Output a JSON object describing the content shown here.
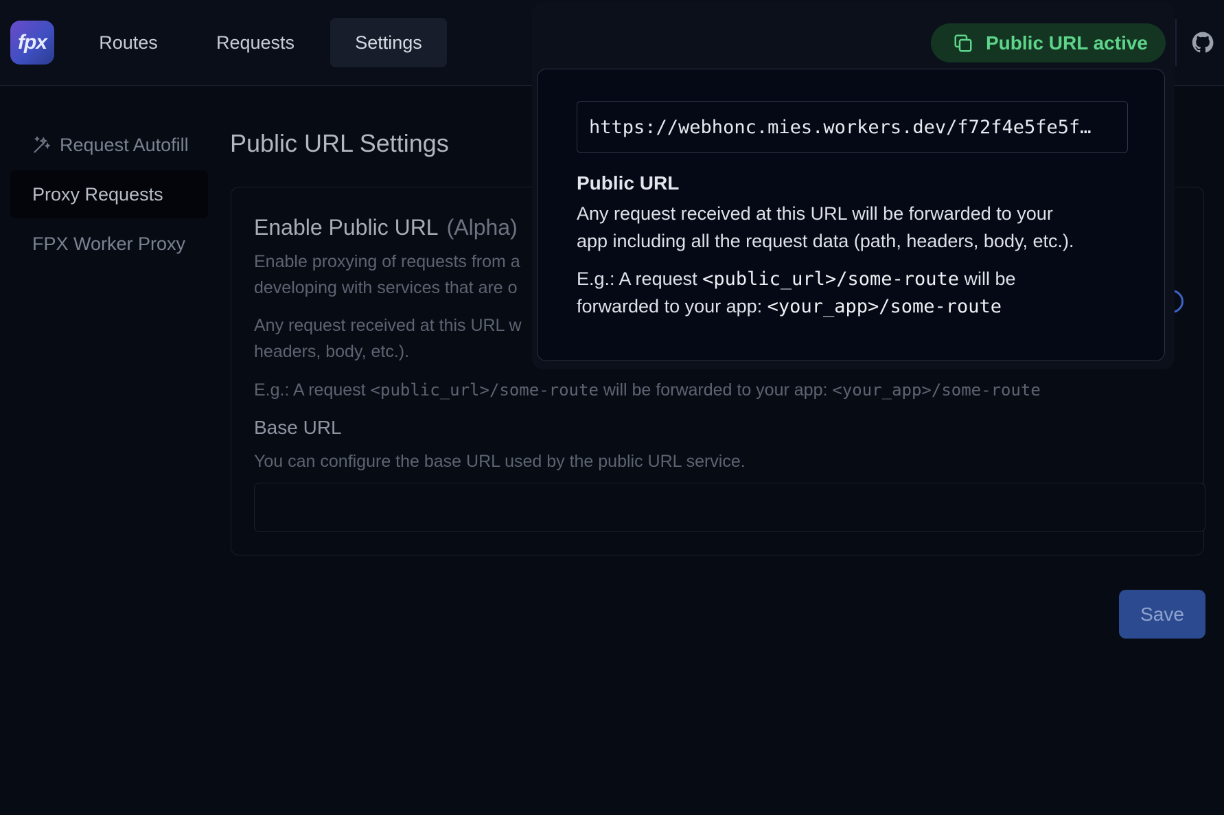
{
  "nav": {
    "logo_text": "fpx",
    "tabs": [
      {
        "label": "Routes"
      },
      {
        "label": "Requests"
      },
      {
        "label": "Settings"
      }
    ]
  },
  "sidebar": {
    "items": [
      {
        "label": "Request Autofill",
        "icon": "magic-wand-icon"
      },
      {
        "label": "Proxy Requests"
      },
      {
        "label": "FPX Worker Proxy"
      }
    ]
  },
  "main": {
    "title": "Public URL Settings",
    "card": {
      "title": "Enable Public URL",
      "badge": "(Alpha)",
      "desc_line1": "Enable proxying of requests from a",
      "desc_line2": "developing with services that are o",
      "desc2_line1": "Any request received at this URL w",
      "desc2_line2": "headers, body, etc.).",
      "eg_prefix": "E.g.: A request ",
      "eg_public": "<public_url>/some-route",
      "eg_mid": " will be forwarded to your app: ",
      "eg_app": "<your_app>/some-route",
      "base_url_label": "Base URL",
      "base_url_desc": "You can configure the base URL used by the public URL service.",
      "base_url_value": ""
    },
    "save_label": "Save"
  },
  "status": {
    "public_url_label": "Public URL active",
    "accent_color": "#5dd58a"
  },
  "popover": {
    "url": "https://webhonc.mies.workers.dev/f72f4e5fe5f…",
    "heading": "Public URL",
    "text_line1": "Any request received at this URL will be forwarded to your",
    "text_line2": "app including all the request data (path, headers, body, etc.).",
    "eg_prefix": "E.g.: A request ",
    "eg_public": "<public_url>/some-route",
    "eg_suffix": " will be",
    "eg_line2_prefix": "forwarded to your app: ",
    "eg_app": "<your_app>/some-route"
  }
}
